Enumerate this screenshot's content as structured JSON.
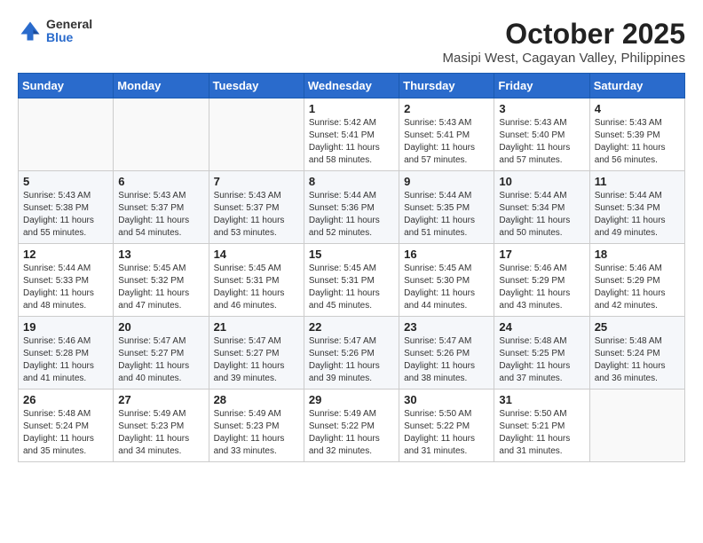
{
  "header": {
    "logo_general": "General",
    "logo_blue": "Blue",
    "month_title": "October 2025",
    "location": "Masipi West, Cagayan Valley, Philippines"
  },
  "weekdays": [
    "Sunday",
    "Monday",
    "Tuesday",
    "Wednesday",
    "Thursday",
    "Friday",
    "Saturday"
  ],
  "weeks": [
    [
      {
        "day": "",
        "info": ""
      },
      {
        "day": "",
        "info": ""
      },
      {
        "day": "",
        "info": ""
      },
      {
        "day": "1",
        "info": "Sunrise: 5:42 AM\nSunset: 5:41 PM\nDaylight: 11 hours\nand 58 minutes."
      },
      {
        "day": "2",
        "info": "Sunrise: 5:43 AM\nSunset: 5:41 PM\nDaylight: 11 hours\nand 57 minutes."
      },
      {
        "day": "3",
        "info": "Sunrise: 5:43 AM\nSunset: 5:40 PM\nDaylight: 11 hours\nand 57 minutes."
      },
      {
        "day": "4",
        "info": "Sunrise: 5:43 AM\nSunset: 5:39 PM\nDaylight: 11 hours\nand 56 minutes."
      }
    ],
    [
      {
        "day": "5",
        "info": "Sunrise: 5:43 AM\nSunset: 5:38 PM\nDaylight: 11 hours\nand 55 minutes."
      },
      {
        "day": "6",
        "info": "Sunrise: 5:43 AM\nSunset: 5:37 PM\nDaylight: 11 hours\nand 54 minutes."
      },
      {
        "day": "7",
        "info": "Sunrise: 5:43 AM\nSunset: 5:37 PM\nDaylight: 11 hours\nand 53 minutes."
      },
      {
        "day": "8",
        "info": "Sunrise: 5:44 AM\nSunset: 5:36 PM\nDaylight: 11 hours\nand 52 minutes."
      },
      {
        "day": "9",
        "info": "Sunrise: 5:44 AM\nSunset: 5:35 PM\nDaylight: 11 hours\nand 51 minutes."
      },
      {
        "day": "10",
        "info": "Sunrise: 5:44 AM\nSunset: 5:34 PM\nDaylight: 11 hours\nand 50 minutes."
      },
      {
        "day": "11",
        "info": "Sunrise: 5:44 AM\nSunset: 5:34 PM\nDaylight: 11 hours\nand 49 minutes."
      }
    ],
    [
      {
        "day": "12",
        "info": "Sunrise: 5:44 AM\nSunset: 5:33 PM\nDaylight: 11 hours\nand 48 minutes."
      },
      {
        "day": "13",
        "info": "Sunrise: 5:45 AM\nSunset: 5:32 PM\nDaylight: 11 hours\nand 47 minutes."
      },
      {
        "day": "14",
        "info": "Sunrise: 5:45 AM\nSunset: 5:31 PM\nDaylight: 11 hours\nand 46 minutes."
      },
      {
        "day": "15",
        "info": "Sunrise: 5:45 AM\nSunset: 5:31 PM\nDaylight: 11 hours\nand 45 minutes."
      },
      {
        "day": "16",
        "info": "Sunrise: 5:45 AM\nSunset: 5:30 PM\nDaylight: 11 hours\nand 44 minutes."
      },
      {
        "day": "17",
        "info": "Sunrise: 5:46 AM\nSunset: 5:29 PM\nDaylight: 11 hours\nand 43 minutes."
      },
      {
        "day": "18",
        "info": "Sunrise: 5:46 AM\nSunset: 5:29 PM\nDaylight: 11 hours\nand 42 minutes."
      }
    ],
    [
      {
        "day": "19",
        "info": "Sunrise: 5:46 AM\nSunset: 5:28 PM\nDaylight: 11 hours\nand 41 minutes."
      },
      {
        "day": "20",
        "info": "Sunrise: 5:47 AM\nSunset: 5:27 PM\nDaylight: 11 hours\nand 40 minutes."
      },
      {
        "day": "21",
        "info": "Sunrise: 5:47 AM\nSunset: 5:27 PM\nDaylight: 11 hours\nand 39 minutes."
      },
      {
        "day": "22",
        "info": "Sunrise: 5:47 AM\nSunset: 5:26 PM\nDaylight: 11 hours\nand 39 minutes."
      },
      {
        "day": "23",
        "info": "Sunrise: 5:47 AM\nSunset: 5:26 PM\nDaylight: 11 hours\nand 38 minutes."
      },
      {
        "day": "24",
        "info": "Sunrise: 5:48 AM\nSunset: 5:25 PM\nDaylight: 11 hours\nand 37 minutes."
      },
      {
        "day": "25",
        "info": "Sunrise: 5:48 AM\nSunset: 5:24 PM\nDaylight: 11 hours\nand 36 minutes."
      }
    ],
    [
      {
        "day": "26",
        "info": "Sunrise: 5:48 AM\nSunset: 5:24 PM\nDaylight: 11 hours\nand 35 minutes."
      },
      {
        "day": "27",
        "info": "Sunrise: 5:49 AM\nSunset: 5:23 PM\nDaylight: 11 hours\nand 34 minutes."
      },
      {
        "day": "28",
        "info": "Sunrise: 5:49 AM\nSunset: 5:23 PM\nDaylight: 11 hours\nand 33 minutes."
      },
      {
        "day": "29",
        "info": "Sunrise: 5:49 AM\nSunset: 5:22 PM\nDaylight: 11 hours\nand 32 minutes."
      },
      {
        "day": "30",
        "info": "Sunrise: 5:50 AM\nSunset: 5:22 PM\nDaylight: 11 hours\nand 31 minutes."
      },
      {
        "day": "31",
        "info": "Sunrise: 5:50 AM\nSunset: 5:21 PM\nDaylight: 11 hours\nand 31 minutes."
      },
      {
        "day": "",
        "info": ""
      }
    ]
  ]
}
